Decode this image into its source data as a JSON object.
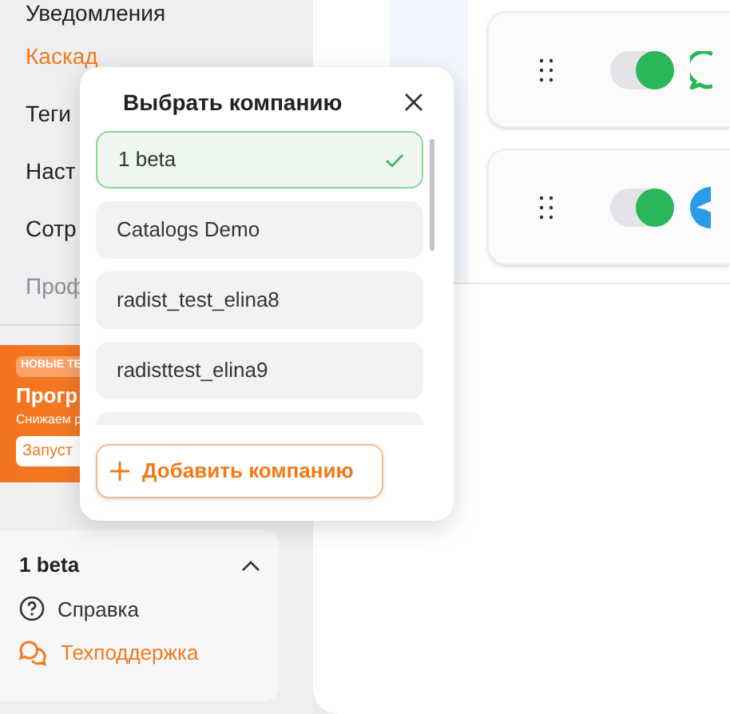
{
  "sidebar": {
    "menu": [
      {
        "label": "Уведомления",
        "selected": false,
        "faded": false
      },
      {
        "label": "Каскад",
        "selected": true,
        "faded": false
      },
      {
        "label": "Теги",
        "selected": false,
        "faded": false
      },
      {
        "label": "Наст",
        "selected": false,
        "faded": false
      },
      {
        "label": "Сотр",
        "selected": false,
        "faded": false
      },
      {
        "label": "Проф",
        "selected": false,
        "faded": true
      }
    ],
    "promo": {
      "badge": "НОВЫЕ ТЕ",
      "title": "Прогр",
      "subtitle": "Снижаем р",
      "button": "Запуст"
    },
    "account": {
      "name": "1 beta",
      "expanded": true
    },
    "links": [
      {
        "label": "Справка",
        "kind": "help"
      },
      {
        "label": "Техподдержка",
        "kind": "support"
      }
    ]
  },
  "channels": [
    {
      "kind": "whatsapp",
      "on": true
    },
    {
      "kind": "telegram",
      "on": true
    }
  ],
  "dialog": {
    "title": "Выбрать компанию",
    "companies": [
      {
        "name": "1 beta",
        "selected": true
      },
      {
        "name": "Catalogs Demo",
        "selected": false
      },
      {
        "name": "radist_test_elina8",
        "selected": false
      },
      {
        "name": "radisttest_elina9",
        "selected": false
      }
    ],
    "add_button": "Добавить компанию"
  }
}
